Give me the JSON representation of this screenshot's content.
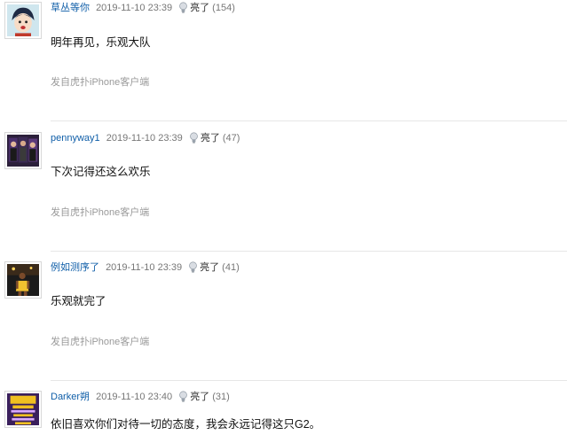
{
  "replies": [
    {
      "author": "草丛等你",
      "time": "2019-11-10 23:39",
      "light_label": "亮了",
      "light_count": "(154)",
      "content": "明年再见，乐观大队",
      "source": "发自虎扑iPhone客户端"
    },
    {
      "author": "pennyway1",
      "time": "2019-11-10 23:39",
      "light_label": "亮了",
      "light_count": "(47)",
      "content": "下次记得还这么欢乐",
      "source": "发自虎扑iPhone客户端"
    },
    {
      "author": "例如测序了",
      "time": "2019-11-10 23:39",
      "light_label": "亮了",
      "light_count": "(41)",
      "content": "乐观就完了",
      "source": "发自虎扑iPhone客户端"
    },
    {
      "author": "Darker朔",
      "time": "2019-11-10 23:40",
      "light_label": "亮了",
      "light_count": "(31)",
      "content": "依旧喜欢你们对待一切的态度，我会永远记得这只G2。",
      "source": ""
    }
  ],
  "colors": {
    "author": "#0f5ea8",
    "time": "#777777",
    "source": "#9a9a9a",
    "divider": "#e6e6e6"
  },
  "icons": {
    "light": "lightbulb-icon"
  }
}
